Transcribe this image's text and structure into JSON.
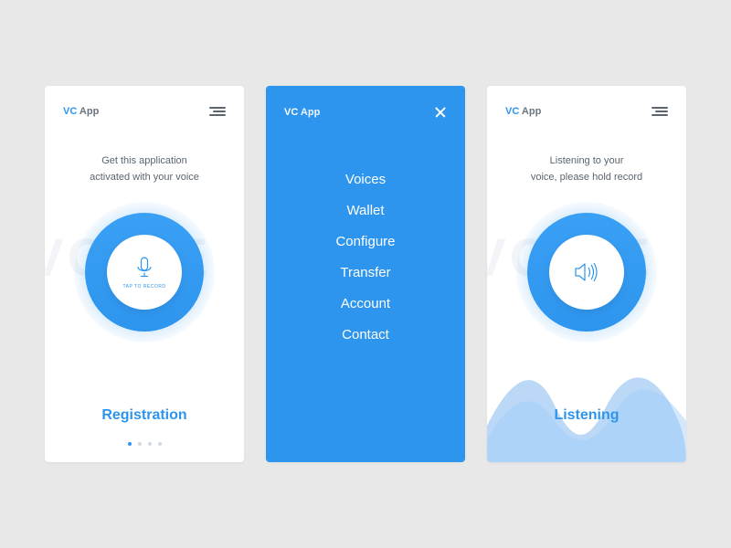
{
  "brand": {
    "short": "VC",
    "suffix": " App"
  },
  "bg_text": "VOICE",
  "screen1": {
    "intro_line1": "Get this application",
    "intro_line2": "activated with your voice",
    "tap_label": "TAP TO RECORD",
    "title": "Registration"
  },
  "menu": {
    "items": [
      "Voices",
      "Wallet",
      "Configure",
      "Transfer",
      "Account",
      "Contact"
    ]
  },
  "screen3": {
    "intro_line1": "Listening to your",
    "intro_line2": "voice, please hold record",
    "title": "Listening"
  }
}
